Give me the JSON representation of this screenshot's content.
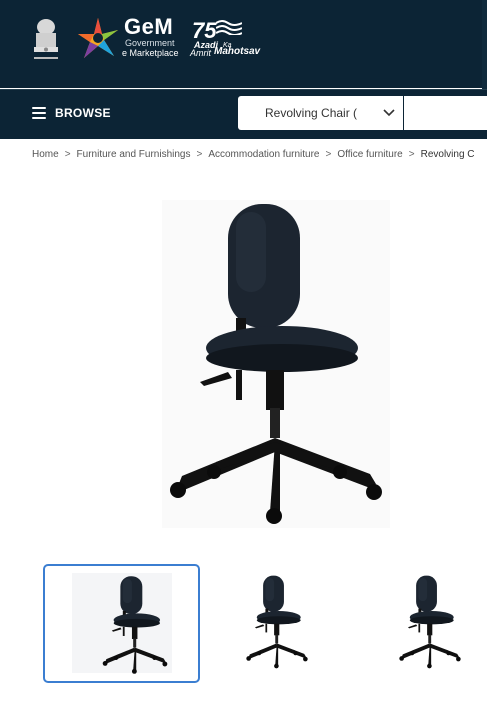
{
  "header": {
    "gem_title": "GeM",
    "gem_sub_line1": "Government",
    "gem_sub_line2": "e Marketplace",
    "azadi_number": "75",
    "azadi_word": "Azadi",
    "azadi_ka": "Ka",
    "azadi_amrit": "Amrit",
    "azadi_mahotsav": "Mahotsav"
  },
  "nav": {
    "browse_label": "BROWSE",
    "category_selected": "Revolving Chair (\\",
    "search_placeholder": ""
  },
  "breadcrumb": {
    "items": [
      "Home",
      "Furniture and Furnishings",
      "Accommodation furniture",
      "Office furniture"
    ],
    "current": "Revolving C",
    "separator": ">"
  },
  "product": {
    "main_image": "office-chair-image",
    "thumbnails": [
      {
        "name": "office-chair-image",
        "selected": true
      },
      {
        "name": "office-chair-image",
        "selected": false
      },
      {
        "name": "office-chair-image",
        "selected": false
      }
    ]
  },
  "colors": {
    "header_bg": "#0c2435",
    "thumb_selected_border": "#3b7ed1",
    "chair": "#1c2530"
  }
}
